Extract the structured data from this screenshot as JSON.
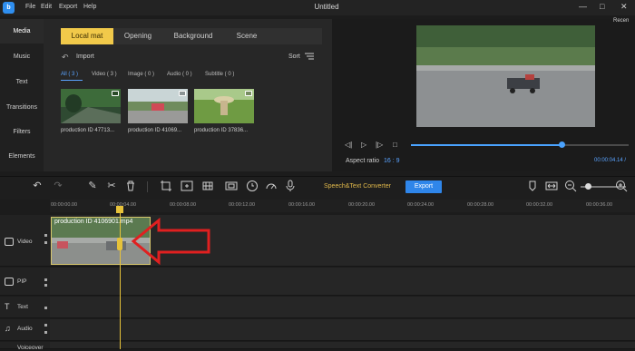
{
  "app": {
    "logo_text": "b",
    "menu": [
      "File",
      "Edit",
      "Export",
      "Help"
    ],
    "title": "Untitled",
    "window_controls": [
      "minimize-icon",
      "maximize-icon",
      "close-icon"
    ]
  },
  "left_nav": {
    "items": [
      "Media",
      "Music",
      "Text",
      "Transitions",
      "Filters",
      "Elements"
    ],
    "active": "Media"
  },
  "media_panel": {
    "tabs": [
      "Local mat",
      "Opening",
      "Background",
      "Scene"
    ],
    "active_tab": "Local mat",
    "import_label": "Import",
    "sort_label": "Sort",
    "filters": [
      "All ( 3 )",
      "Video ( 3 )",
      "Image ( 0 )",
      "Audio ( 0 )",
      "Subtitle ( 0 )"
    ],
    "active_filter": "All ( 3 )",
    "items": [
      {
        "caption": "production ID 47713..."
      },
      {
        "caption": "production ID 41069..."
      },
      {
        "caption": "production ID 37836..."
      }
    ]
  },
  "preview": {
    "recent_label": "Recen",
    "aspect_ratio_label": "Aspect ratio",
    "aspect_ratio_value": "16 : 9",
    "timecode": "00:00:04.14",
    "timecode_sep": "/",
    "progress": 0.69,
    "controls": [
      "prev-frame-icon",
      "play-icon",
      "next-frame-icon",
      "stop-icon"
    ]
  },
  "toolbar": {
    "tools": [
      "undo-icon",
      "redo-icon",
      "edit-icon",
      "cut-icon",
      "delete-icon",
      "crop-icon",
      "zoom-icon",
      "mosaic-icon",
      "freeze-frame-icon",
      "duration-icon",
      "speed-icon",
      "voiceover-icon"
    ],
    "speech_text_label": "Speech&Text Converter",
    "export_label": "Export",
    "right_tools": [
      "marker-icon",
      "fit-icon",
      "zoom-out-icon",
      "zoom-in-icon"
    ],
    "zoom_level": 0.15
  },
  "timeline": {
    "ruler": [
      "00:00:00.00",
      "00:00:04.00",
      "00:00:08.00",
      "00:00:12.00",
      "00:00:16.00",
      "00:00:20.00",
      "00:00:24.00",
      "00:00:28.00",
      "00:00:32.00",
      "00:00:36.00"
    ],
    "tracks": [
      "Video",
      "PIP",
      "Text",
      "Audio",
      "Voiceover"
    ],
    "clip": {
      "title": "production ID 4106901.mp4"
    }
  }
}
